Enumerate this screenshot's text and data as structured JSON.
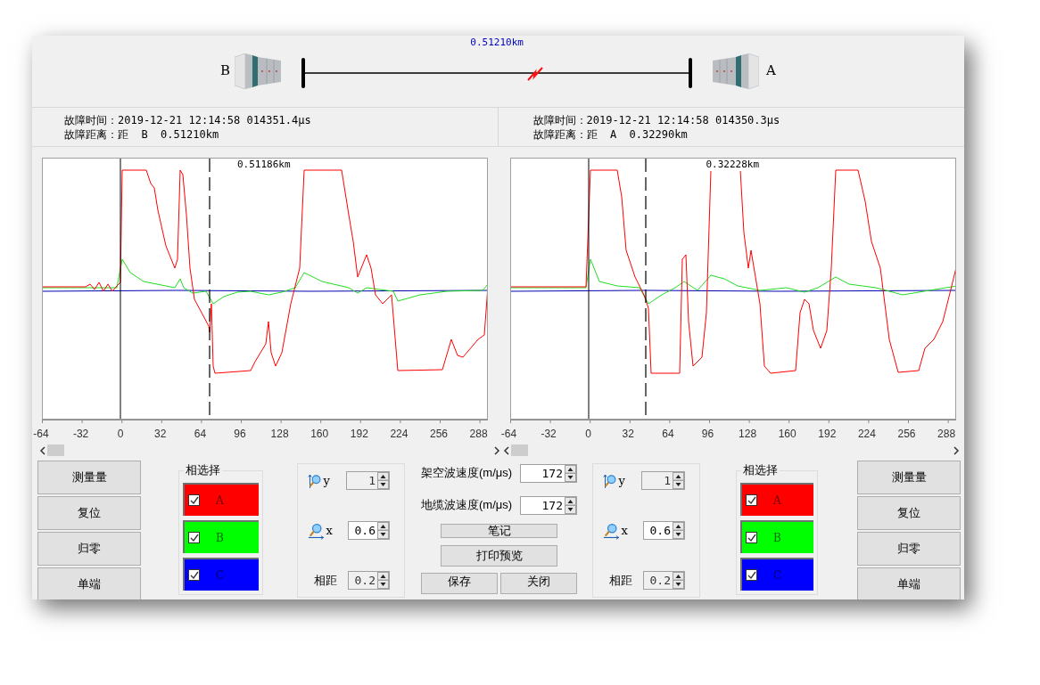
{
  "diagram": {
    "left_station": "B",
    "distance": "0.51210km",
    "right_station": "A"
  },
  "panels": [
    {
      "fault_time": "故障时间：2019-12-21 12:14:58 014351.4μs",
      "fault_distance": "故障距离：距  B  0.51210km",
      "marker": "0.51186km",
      "x_ticks": [
        "-64",
        "-32",
        "0",
        "32",
        "64",
        "96",
        "128",
        "160",
        "192",
        "224",
        "256",
        "288"
      ],
      "buttons": [
        "测量量",
        "复位",
        "归零",
        "单端"
      ],
      "phase_group": {
        "title": "相选择",
        "phases": [
          {
            "label": "A",
            "checked": true,
            "color": "#ff0000"
          },
          {
            "label": "B",
            "checked": true,
            "color": "#00ff00"
          },
          {
            "label": "C",
            "checked": true,
            "color": "#0000ff"
          }
        ]
      },
      "spinners": [
        {
          "kind": "zoom-y",
          "label": "y",
          "value": "1",
          "disabled": true
        },
        {
          "kind": "zoom-x",
          "label": "x",
          "value": "0.6",
          "disabled": false
        },
        {
          "kind": "plain",
          "label": "相距",
          "value": "0.2",
          "disabled": true
        }
      ]
    },
    {
      "fault_time": "故障时间：2019-12-21 12:14:58 014350.3μs",
      "fault_distance": "故障距离：距  A  0.32290km",
      "marker": "0.32228km",
      "x_ticks": [
        "-64",
        "-32",
        "0",
        "32",
        "64",
        "96",
        "128",
        "160",
        "192",
        "224",
        "256",
        "288"
      ],
      "buttons": [
        "测量量",
        "复位",
        "归零",
        "单端"
      ],
      "phase_group": {
        "title": "相选择",
        "phases": [
          {
            "label": "A",
            "checked": true,
            "color": "#ff0000"
          },
          {
            "label": "B",
            "checked": true,
            "color": "#00ff00"
          },
          {
            "label": "C",
            "checked": true,
            "color": "#0000ff"
          }
        ]
      },
      "spinners": [
        {
          "kind": "zoom-y",
          "label": "y",
          "value": "1",
          "disabled": true
        },
        {
          "kind": "zoom-x",
          "label": "x",
          "value": "0.6",
          "disabled": false
        },
        {
          "kind": "plain",
          "label": "相距",
          "value": "0.2",
          "disabled": true
        }
      ]
    }
  ],
  "speeds": [
    {
      "label": "架空波速度(m/μs)",
      "value": "172"
    },
    {
      "label": "地缆波速度(m/μs)",
      "value": "172"
    }
  ],
  "actions": [
    "笔记",
    "打印预览",
    "保存",
    "关闭"
  ]
}
